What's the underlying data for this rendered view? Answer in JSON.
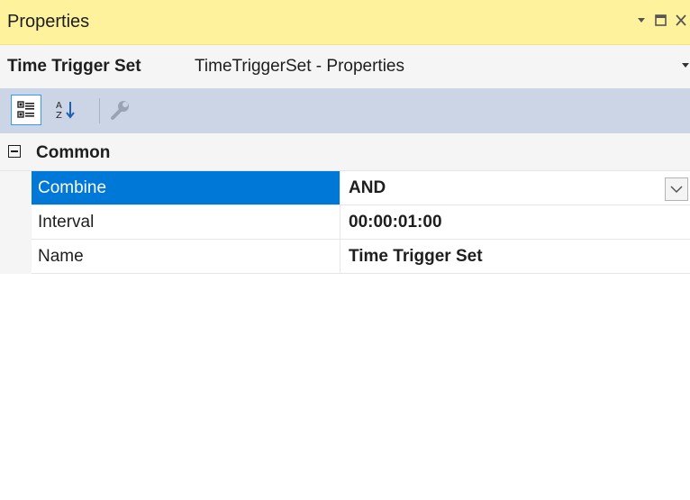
{
  "panel": {
    "title": "Properties",
    "controls": {
      "menu_icon": "dropdown-arrow-icon",
      "maximize_icon": "maximize-icon",
      "close_icon": "close-icon"
    }
  },
  "object_selector": {
    "name": "Time Trigger Set",
    "type": "TimeTriggerSet - Properties"
  },
  "toolbar": {
    "buttons": [
      {
        "icon": "categorized-icon",
        "active": true
      },
      {
        "icon": "alphabetical-sort-icon",
        "active": false
      },
      {
        "icon": "wrench-icon",
        "active": false
      }
    ]
  },
  "property_grid": {
    "category": "Common",
    "rows": [
      {
        "name": "Combine",
        "value": "AND",
        "selected": true,
        "has_dropdown": true
      },
      {
        "name": "Interval",
        "value": "00:00:01:00",
        "selected": false
      },
      {
        "name": "Name",
        "value": "Time Trigger Set",
        "selected": false
      }
    ]
  },
  "colors": {
    "title_background": "#fff29d",
    "toolbar_background": "#ccd5e6",
    "selection": "#0078d7"
  }
}
